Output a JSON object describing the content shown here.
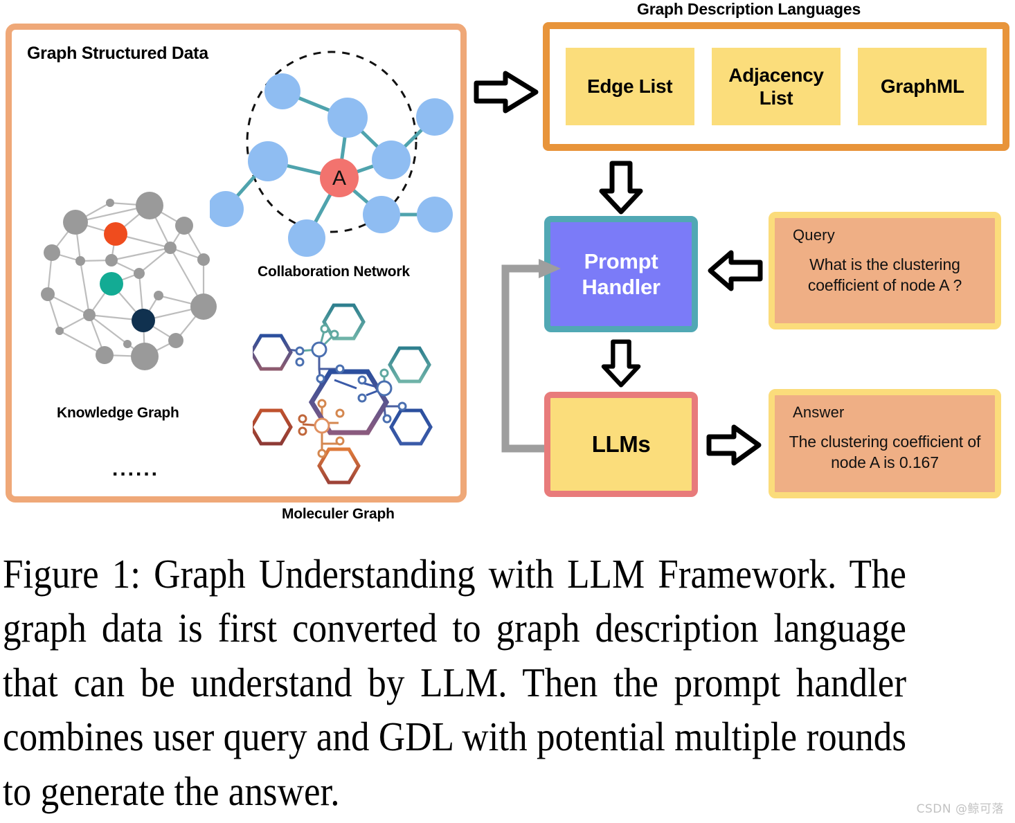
{
  "left_panel": {
    "title": "Graph Structured Data",
    "collaboration_caption": "Collaboration Network",
    "knowledge_caption": "Knowledge Graph",
    "molecule_caption": "Moleculer Graph",
    "ellipsis": "......",
    "center_node_label": "A",
    "border_color": "#efa878",
    "collab_node_color": "#8fbdf2",
    "collab_center_color": "#f2736e",
    "collab_edge_color": "#4fa3ad",
    "knowledge_node_color": "#9a9a9a",
    "knowledge_highlight_colors": [
      "#ef4c1e",
      "#13ab94",
      "#10314f"
    ],
    "molecule_colors": [
      "#2b4f9e",
      "#2e7f8e",
      "#7a5a8e",
      "#c0522e",
      "#e07b3a"
    ]
  },
  "gdl": {
    "title": "Graph Description Languages",
    "border_color": "#e8943a",
    "chip_color": "#fbdd7b",
    "items": [
      {
        "label": "Edge List"
      },
      {
        "label": "Adjacency List"
      },
      {
        "label": "GraphML"
      }
    ]
  },
  "flow": {
    "prompt_handler": {
      "label": "Prompt Handler",
      "fill": "#7b7bf8",
      "border": "#51a8b4",
      "text_color": "#ffffff"
    },
    "llms": {
      "label": "LLMs",
      "fill": "#fbdd7b",
      "border": "#e87b7b",
      "text_color": "#000000"
    },
    "feedback_arrow_color": "#9e9e9e",
    "block_arrow_color": "#000000"
  },
  "query": {
    "label": "Query",
    "text": "What is the clustering coefficient of node A ?",
    "fill": "#efaf85",
    "border": "#fbdc7b"
  },
  "answer": {
    "label": "Answer",
    "text": "The clustering coefficient of node A is 0.167",
    "fill": "#efaf85",
    "border": "#fbdc7b"
  },
  "caption": {
    "text": "Figure 1: Graph Understanding with LLM Framework. The graph data is first converted to graph description language that can be understand by LLM. Then the prompt handler combines user query and GDL with potential multiple rounds to generate the answer."
  },
  "watermark": {
    "text": "CSDN @鲸可落"
  }
}
